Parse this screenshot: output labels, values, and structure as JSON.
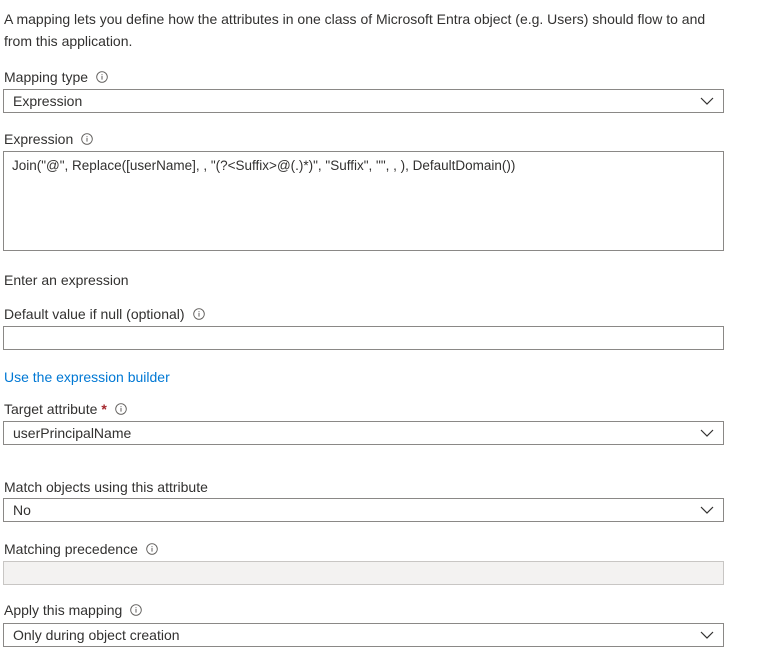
{
  "intro": {
    "text": "A mapping lets you define how the attributes in one class of Microsoft Entra object (e.g. Users) should flow to and from this application."
  },
  "mapping_type": {
    "label": "Mapping type",
    "value": "Expression"
  },
  "expression": {
    "label": "Expression",
    "value": "Join(\"@\", Replace([userName], , \"(?<Suffix>@(.)*)\", \"Suffix\", \"\", , ), DefaultDomain())",
    "hint": "Enter an expression"
  },
  "default_value": {
    "label": "Default value if null (optional)",
    "value": ""
  },
  "expression_builder_link": "Use the expression builder",
  "target_attribute": {
    "label": "Target attribute",
    "required_marker": "*",
    "value": "userPrincipalName"
  },
  "match_objects": {
    "label": "Match objects using this attribute",
    "value": "No"
  },
  "matching_precedence": {
    "label": "Matching precedence",
    "value": ""
  },
  "apply_mapping": {
    "label": "Apply this mapping",
    "value": "Only during object creation"
  },
  "colors": {
    "text": "#323130",
    "link": "#0078d4",
    "border": "#8a8886",
    "required": "#a4262c",
    "disabled_bg": "#f3f2f1"
  },
  "icons": {
    "info": "info-icon",
    "dropdown": "chevron-down-icon"
  }
}
